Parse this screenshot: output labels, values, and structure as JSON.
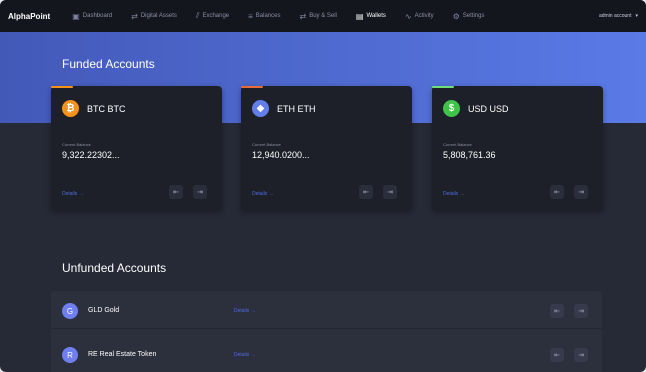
{
  "nav": {
    "brand": "AlphaPoint",
    "items": [
      {
        "label": "Dashboard",
        "icon": "dashboard-icon",
        "glyph": "▣"
      },
      {
        "label": "Digital Assets",
        "icon": "transfer-icon",
        "glyph": "⇄"
      },
      {
        "label": "Exchange",
        "icon": "chart-icon",
        "glyph": "⫽"
      },
      {
        "label": "Balances",
        "icon": "list-icon",
        "glyph": "≡"
      },
      {
        "label": "Buy & Sell",
        "icon": "swap-icon",
        "glyph": "⇄"
      },
      {
        "label": "Wallets",
        "icon": "wallet-icon",
        "glyph": "▤"
      },
      {
        "label": "Activity",
        "icon": "activity-icon",
        "glyph": "∿"
      },
      {
        "label": "Settings",
        "icon": "gear-icon",
        "glyph": "⚙"
      }
    ],
    "account": "admin account",
    "account_glyph": "▾"
  },
  "funded": {
    "title": "Funded Accounts",
    "balance_label": "Current Balance",
    "details_label": "Details →",
    "send_glyph": "⇤",
    "receive_glyph": "⇥",
    "cards": [
      {
        "name": "BTC BTC",
        "balance": "9,322.22302...",
        "coin_glyph": "₿",
        "coin_color": "#f7931a",
        "strip_color": "#f7931a"
      },
      {
        "name": "ETH ETH",
        "balance": "12,940.0200...",
        "coin_glyph": "◆",
        "coin_color": "#627eea",
        "strip_color": "#e86b3a"
      },
      {
        "name": "USD USD",
        "balance": "5,808,761.36",
        "coin_glyph": "$",
        "coin_color": "#3fc14a",
        "strip_color": "#6ee07a"
      }
    ]
  },
  "unfunded": {
    "title": "Unfunded Accounts",
    "details_label": "Details →",
    "rows": [
      {
        "initial": "G",
        "name": "GLD Gold"
      },
      {
        "initial": "R",
        "name": "RE Real Estate Token"
      }
    ]
  }
}
